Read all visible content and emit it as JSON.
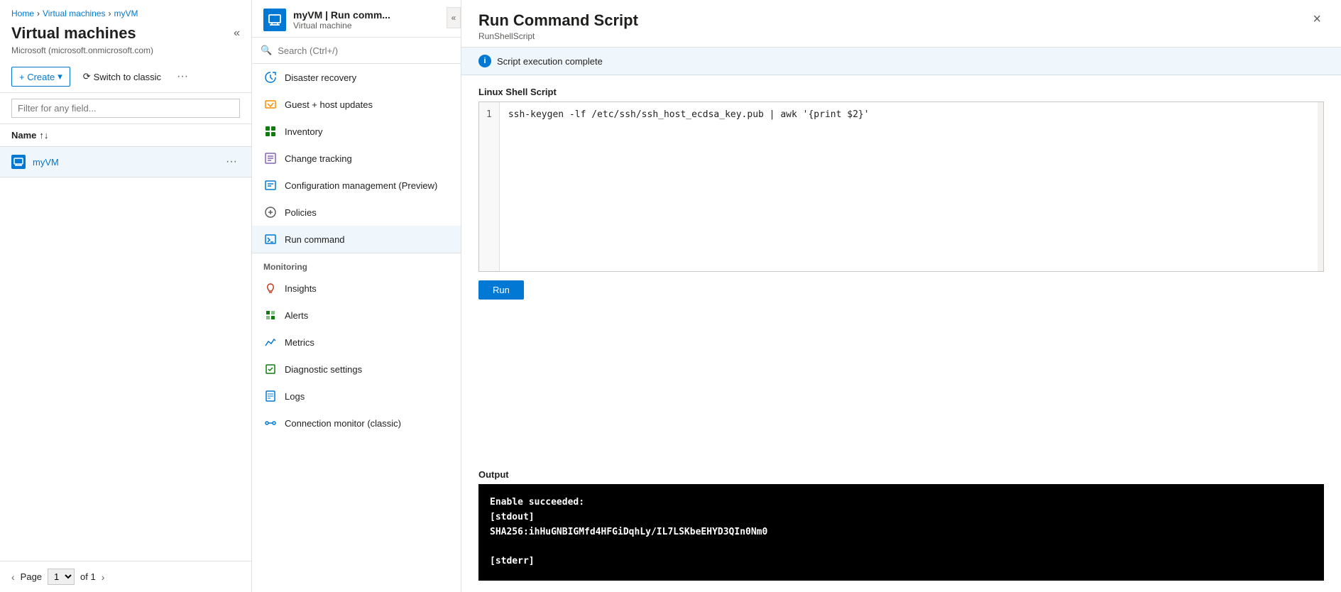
{
  "breadcrumb": {
    "home": "Home",
    "vms": "Virtual machines",
    "current": "myVM"
  },
  "left": {
    "title": "Virtual machines",
    "subtitle": "Microsoft (microsoft.onmicrosoft.com)",
    "create_label": "+ Create",
    "switch_label": "Switch to classic",
    "filter_placeholder": "Filter for any field...",
    "table_name_header": "Name",
    "vm_name": "myVM",
    "pagination": {
      "page": "1",
      "total": "of 1"
    }
  },
  "middle": {
    "vm_title": "myVM | Run comm...",
    "vm_subtitle": "Virtual machine",
    "search_placeholder": "Search (Ctrl+/)",
    "menu_items": [
      {
        "label": "Disaster recovery",
        "icon": "disaster"
      },
      {
        "label": "Guest + host updates",
        "icon": "updates"
      },
      {
        "label": "Inventory",
        "icon": "inventory"
      },
      {
        "label": "Change tracking",
        "icon": "change"
      },
      {
        "label": "Configuration management (Preview)",
        "icon": "config"
      },
      {
        "label": "Policies",
        "icon": "policy"
      },
      {
        "label": "Run command",
        "icon": "run",
        "active": true
      }
    ],
    "monitoring_section": "Monitoring",
    "monitoring_items": [
      {
        "label": "Insights",
        "icon": "insights"
      },
      {
        "label": "Alerts",
        "icon": "alerts"
      },
      {
        "label": "Metrics",
        "icon": "metrics"
      },
      {
        "label": "Diagnostic settings",
        "icon": "diag"
      },
      {
        "label": "Logs",
        "icon": "logs"
      },
      {
        "label": "Connection monitor (classic)",
        "icon": "conn"
      }
    ]
  },
  "right": {
    "title": "Run Command Script",
    "subtitle": "RunShellScript",
    "close_label": "×",
    "notification": "Script execution complete",
    "script_label": "Linux Shell Script",
    "script_line_number": "1",
    "script_code": "ssh-keygen -lf /etc/ssh/ssh_host_ecdsa_key.pub | awk '{print $2}'",
    "run_button": "Run",
    "output_label": "Output",
    "output_lines": [
      "Enable succeeded:",
      "[stdout]",
      "SHA256:ihHuGNBIGMfd4HFGiDqhLy/IL7LSKbeEHYD3QIn0Nm0",
      "",
      "[stderr]"
    ]
  }
}
